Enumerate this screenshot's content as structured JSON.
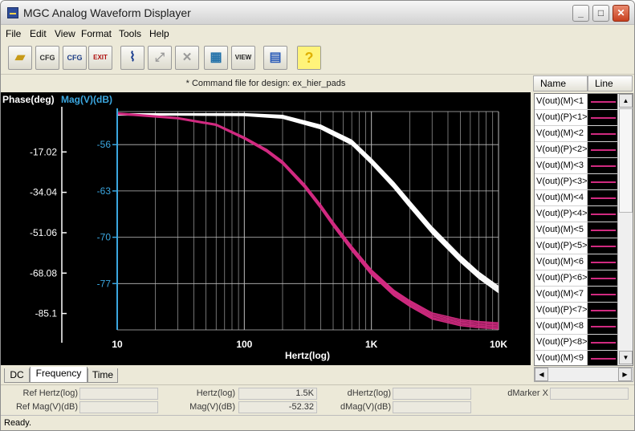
{
  "window": {
    "title": "MGC Analog Waveform Displayer"
  },
  "menu": [
    "File",
    "Edit",
    "View",
    "Format",
    "Tools",
    "Help"
  ],
  "toolbar": {
    "buttons": [
      {
        "name": "open-icon",
        "glyph": ""
      },
      {
        "name": "config-icon",
        "glyph": "CFG"
      },
      {
        "name": "save-config-icon",
        "glyph": "CFG"
      },
      {
        "name": "exit-icon",
        "glyph": "EXIT"
      },
      {
        "name": "cursor-icon",
        "glyph": ""
      },
      {
        "name": "zoom-icon",
        "glyph": ""
      },
      {
        "name": "tools-icon",
        "glyph": ""
      },
      {
        "name": "layout-icon",
        "glyph": ""
      },
      {
        "name": "view-icon",
        "glyph": "VIEW"
      },
      {
        "name": "table-icon",
        "glyph": ""
      },
      {
        "name": "help-icon",
        "glyph": "?"
      }
    ]
  },
  "command_line": "* Command file for design: ex_hier_pads",
  "plot": {
    "label_phase": "Phase(deg)",
    "label_mag": "Mag(V)(dB)",
    "xlabel": "Hertz(log)"
  },
  "chart_data": {
    "type": "line",
    "x_scale": "log",
    "xlim": [
      10,
      10000
    ],
    "x_ticks": [
      "10",
      "100",
      "1K",
      "10K"
    ],
    "xlabel": "Hertz(log)",
    "phase_axis": {
      "label": "Phase(deg)",
      "ticks": [
        "-17.02",
        "-34.04",
        "-51.06",
        "-68.08",
        "-85.1"
      ],
      "range": [
        -92,
        0
      ]
    },
    "mag_axis": {
      "label": "Mag(V)(dB)",
      "ticks": [
        "-56",
        "-63",
        "-70",
        "-77"
      ],
      "range": [
        -84,
        -51
      ]
    },
    "series": [
      {
        "color": "#ffffff",
        "axis": "phase",
        "x": [
          10,
          30,
          100,
          200,
          400,
          700,
          1000,
          1500,
          2000,
          3000,
          5000,
          7000,
          10000
        ],
        "y": [
          -1.2,
          -1.2,
          -1.3,
          -2.2,
          -6.5,
          -13,
          -21,
          -31,
          -39,
          -50,
          -62,
          -69,
          -75
        ]
      },
      {
        "color": "#d12a80",
        "axis": "mag",
        "x": [
          10,
          30,
          60,
          100,
          150,
          200,
          300,
          400,
          500,
          700,
          1000,
          1500,
          2000,
          3000,
          5000,
          7000,
          10000
        ],
        "y": [
          -51.3,
          -52,
          -53,
          -55,
          -56.9,
          -58.7,
          -62.3,
          -65.4,
          -68,
          -71.7,
          -75.3,
          -78.4,
          -80,
          -81.9,
          -82.9,
          -83.2,
          -83.4
        ]
      }
    ]
  },
  "signals_header": {
    "name": "Name",
    "line": "Line"
  },
  "signals": [
    {
      "name": "V(out)(M)<1",
      "color": "#d12a80"
    },
    {
      "name": "V(out)(P)<1>",
      "color": "#d12a80"
    },
    {
      "name": "V(out)(M)<2",
      "color": "#d12a80"
    },
    {
      "name": "V(out)(P)<2>",
      "color": "#d12a80"
    },
    {
      "name": "V(out)(M)<3",
      "color": "#d12a80"
    },
    {
      "name": "V(out)(P)<3>",
      "color": "#d12a80"
    },
    {
      "name": "V(out)(M)<4",
      "color": "#d12a80"
    },
    {
      "name": "V(out)(P)<4>",
      "color": "#d12a80"
    },
    {
      "name": "V(out)(M)<5",
      "color": "#d12a80"
    },
    {
      "name": "V(out)(P)<5>",
      "color": "#d12a80"
    },
    {
      "name": "V(out)(M)<6",
      "color": "#d12a80"
    },
    {
      "name": "V(out)(P)<6>",
      "color": "#d12a80"
    },
    {
      "name": "V(out)(M)<7",
      "color": "#d12a80"
    },
    {
      "name": "V(out)(P)<7>",
      "color": "#d12a80"
    },
    {
      "name": "V(out)(M)<8",
      "color": "#d12a80"
    },
    {
      "name": "V(out)(P)<8>",
      "color": "#d12a80"
    },
    {
      "name": "V(out)(M)<9",
      "color": "#d12a80"
    }
  ],
  "tabs": [
    "DC",
    "Frequency",
    "Time"
  ],
  "active_tab": "Frequency",
  "info": {
    "ref_hertz_label": "Ref Hertz(log)",
    "ref_hertz_value": "",
    "ref_mag_label": "Ref Mag(V)(dB)",
    "ref_mag_value": "",
    "hertz_label": "Hertz(log)",
    "hertz_value": "1.5K",
    "mag_label": "Mag(V)(dB)",
    "mag_value": "-52.32",
    "dhertz_label": "dHertz(log)",
    "dhertz_value": "",
    "dmag_label": "dMag(V)(dB)",
    "dmag_value": "",
    "dmarker_label": "dMarker X",
    "dmarker_value": ""
  },
  "status": "Ready.",
  "colors": {
    "phase_axis": "#ffffff",
    "mag_axis": "#3ba7e0",
    "magnitude_trace": "#d12a80",
    "phase_trace": "#ffffff"
  }
}
